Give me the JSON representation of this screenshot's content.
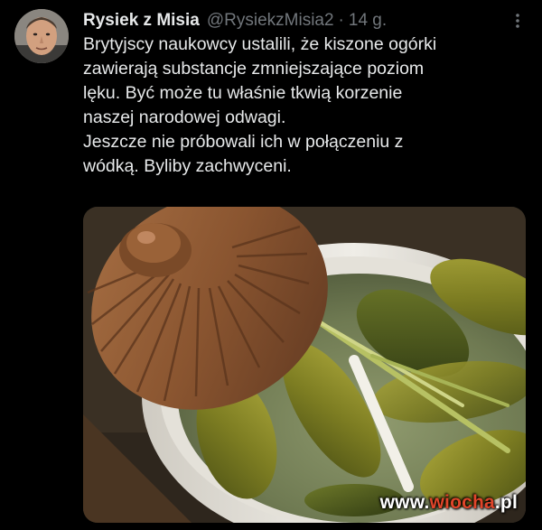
{
  "author": {
    "display_name": "Rysiek z Misia",
    "handle": "@RysiekzMisia2",
    "separator": "·",
    "time": "14 g."
  },
  "icons": {
    "avatar": "user-avatar",
    "more": "more-vertical-icon"
  },
  "tweet": {
    "lines": [
      "Brytyjscy naukowcy ustalili, że kiszone ogórki",
      "zawierają substancje zmniejszające poziom",
      "lęku. Być może tu właśnie tkwią korzenie",
      "naszej narodowej odwagi.",
      "Jeszcze nie próbowali ich w połączeniu z",
      "wódką. Byliby zachwyceni."
    ]
  },
  "media": {
    "watermark_prefix": "www.",
    "watermark_brand": "wiocha",
    "watermark_suffix": ".pl"
  },
  "colors": {
    "background": "#000000",
    "text": "#e7e9ea",
    "muted": "#71767b",
    "watermark_accent": "#e0452a"
  }
}
